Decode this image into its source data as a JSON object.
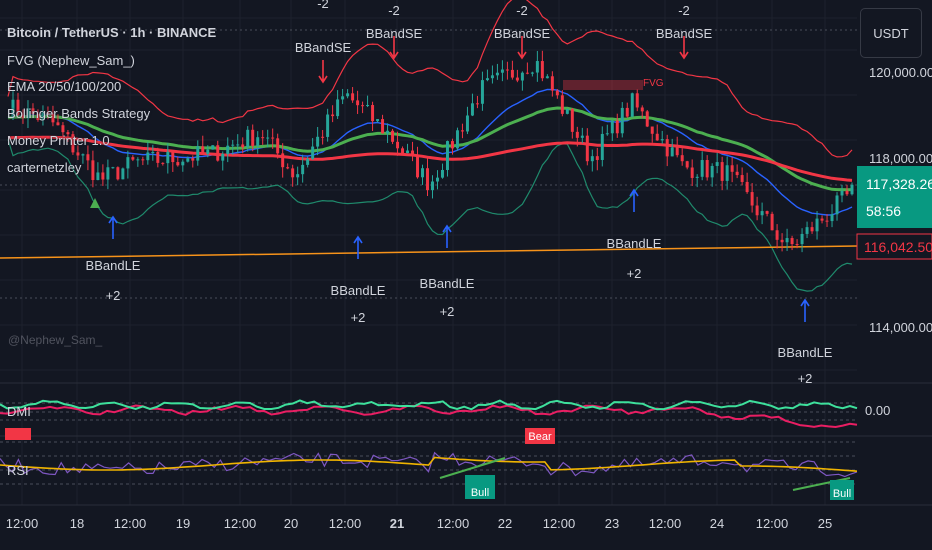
{
  "header": {
    "symbol": "Bitcoin / TetherUS · 1h · BINANCE",
    "currency_button": "USDT"
  },
  "legend_items": [
    "FVG (Nephew_Sam_)",
    "EMA 20/50/100/200",
    "Bollinger Bands Strategy",
    "Money Printer 1.0",
    "carternetzley"
  ],
  "watermark": "@Nephew_Sam_",
  "price_axis": {
    "ticks": [
      "120,000.00",
      "118,000.00",
      "114,000.00"
    ],
    "current_price": "117,328.26",
    "countdown": "58:56",
    "line_price": "116,042.50"
  },
  "time_axis": [
    "12:00",
    "18",
    "12:00",
    "19",
    "12:00",
    "20",
    "12:00",
    "21",
    "12:00",
    "22",
    "12:00",
    "23",
    "12:00",
    "24",
    "12:00",
    "25"
  ],
  "signals": {
    "se": [
      {
        "line1": "-2",
        "line2": "BBandSE"
      },
      {
        "line1": "-2",
        "line2": "BBandSE"
      },
      {
        "line1": "-2",
        "line2": "BBandSE"
      },
      {
        "line1": "-2",
        "line2": "BBandSE"
      }
    ],
    "le": [
      {
        "line1": "BBandLE",
        "line2": "+2"
      },
      {
        "line1": "BBandLE",
        "line2": "+2"
      },
      {
        "line1": "BBandLE",
        "line2": "+2"
      },
      {
        "line1": "BBandLE",
        "line2": "+2"
      },
      {
        "line1": "BBandLE",
        "line2": "+2"
      }
    ]
  },
  "fvg_label": "FVG",
  "dmi": {
    "label": "DMI",
    "value": "0.00"
  },
  "rsi": {
    "label": "RSI",
    "bear_tag": "Bear",
    "bull_tag": "Bull"
  },
  "colors": {
    "background": "#131722",
    "grid": "#1e222d",
    "up": "#26a69a",
    "down": "#f23645",
    "bb_band": "#f23645",
    "bb_lower": "#1f8a6c",
    "ema_blue": "#2962ff",
    "ema_green": "#4caf50",
    "ema_red": "#f23645",
    "hline": "#f7931a",
    "signal_le": "#2962ff",
    "signal_se": "#f23645",
    "rsi_line": "#f0b400",
    "rsi_purple": "#7e57c2",
    "dmi_green": "#3ee09c",
    "dmi_magenta": "#e91e63"
  }
}
